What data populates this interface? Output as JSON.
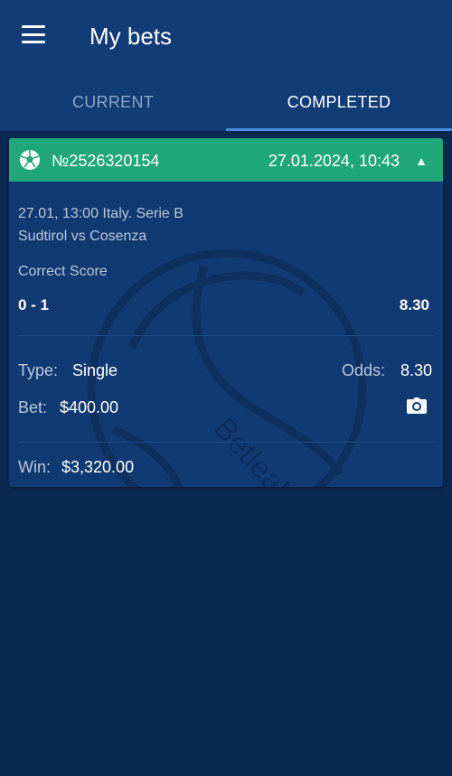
{
  "appbar": {
    "title": "My bets",
    "menu_icon": "hamburger-icon"
  },
  "tabs": [
    {
      "label": "CURRENT",
      "active": false
    },
    {
      "label": "COMPLETED",
      "active": true
    }
  ],
  "colors": {
    "header_green": "#20a779",
    "background": "#0b2852",
    "card": "#123a72",
    "tab_indicator": "#4a90e2"
  },
  "bet": {
    "header_icon": "soccer-ball-icon",
    "number": "№2526320154",
    "placed_at": "27.01.2024,  10:43",
    "collapse_icon": "triangle-up-icon",
    "event_time": "27.01,  13:00  Italy.  Serie  B",
    "match": "Sudtirol  vs  Cosenza",
    "market": "Correct Score",
    "selection": "0  -  1",
    "selection_odds": "8.30",
    "type_label": "Type:",
    "type_value": "Single",
    "odds_label": "Odds:",
    "odds_value": "8.30",
    "bet_label": "Bet:",
    "bet_value": "$400.00",
    "camera_icon": "camera-icon",
    "win_label": "Win:",
    "win_value": "$3,320.00",
    "watermark": "Betleaks"
  }
}
